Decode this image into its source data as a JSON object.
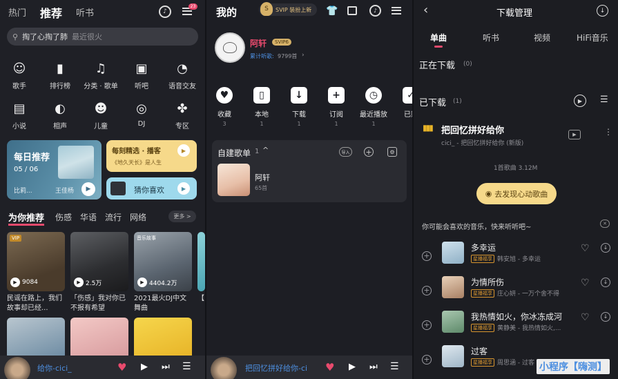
{
  "left_panel": {
    "tabs": [
      "热门",
      "推荐",
      "听书"
    ],
    "notification_badge": "23",
    "search": {
      "hot": "掏了心掏了肺",
      "hint": "最近很火"
    },
    "categories": [
      {
        "icon": "singer-icon",
        "label": "歌手"
      },
      {
        "icon": "ranking-icon",
        "label": "排行榜"
      },
      {
        "icon": "song-sheet-icon",
        "label": "分类 · 歌单"
      },
      {
        "icon": "radio-icon",
        "label": "听吧"
      },
      {
        "icon": "chat-icon",
        "label": "语音交友"
      },
      {
        "icon": "novel-icon",
        "label": "小说"
      },
      {
        "icon": "crosstalk-icon",
        "label": "相声"
      },
      {
        "icon": "kids-icon",
        "label": "儿童"
      },
      {
        "icon": "dj-icon",
        "label": "DJ"
      },
      {
        "icon": "zone-icon",
        "label": "专区"
      }
    ],
    "daily": {
      "title": "每日推荐",
      "date": "05 / 06",
      "song": "比莉...",
      "artist": "王佳杨"
    },
    "moment": {
      "title": "每刻精选 · 播客",
      "subtitle": "《地久天长》是人生"
    },
    "guess": {
      "title": "猜你喜欢"
    },
    "rec_tabs": [
      "为你推荐",
      "伤感",
      "华语",
      "流行",
      "网络"
    ],
    "more": "更多 >",
    "tiles": [
      {
        "tag": "VIP",
        "plays": "9084",
        "caption": "民谣在路上，我们故事却已经..."
      },
      {
        "tag": "",
        "plays": "2.5万",
        "caption": "「伤感」我对你已不报有希望"
      },
      {
        "tag": "音乐故事",
        "plays": "4404.2万",
        "caption": "2021最火DJ中文舞曲"
      },
      {
        "tag": "",
        "plays": "",
        "caption": "【..."
      }
    ],
    "player": {
      "now": "给你-cici_"
    }
  },
  "middle_panel": {
    "title": "我的",
    "svip_banner": "SVIP 装扮上新",
    "user": {
      "name": "阿轩",
      "level": "SVIP6",
      "listen_label": "累计听歌:",
      "listen_count": "9799首"
    },
    "functions": [
      {
        "icon": "heart-icon",
        "label": "收藏",
        "count": "3"
      },
      {
        "icon": "phone-icon",
        "label": "本地",
        "count": "1"
      },
      {
        "icon": "download-icon",
        "label": "下载",
        "count": "1"
      },
      {
        "icon": "subscribe-icon",
        "label": "订阅",
        "count": "1"
      },
      {
        "icon": "clock-icon",
        "label": "最近播放",
        "count": "1"
      },
      {
        "icon": "check-icon",
        "label": "已购",
        "count": ""
      }
    ],
    "playlist_header": {
      "title": "自建歌单",
      "count": "1",
      "import": "导入"
    },
    "playlist": {
      "name": "阿轩",
      "count": "65首"
    },
    "player": {
      "now": "把回忆拼好给你-ci"
    }
  },
  "right_panel": {
    "title": "下载管理",
    "tabs": [
      "单曲",
      "听书",
      "视频",
      "HiFi音乐"
    ],
    "downloading": {
      "label": "正在下载",
      "count": "(0)"
    },
    "downloaded": {
      "label": "已下载",
      "count": "(1)"
    },
    "track": {
      "title": "把回忆拼好给你",
      "sub": "cici_ - 把回忆拼好给你 (新版)"
    },
    "summary": "1首歌曲  3.12M",
    "discover_button": "去发现心动歌曲",
    "maybe_like": "你可能会喜欢的音乐，快来听听吧~",
    "songs": [
      {
        "title": "多幸运",
        "badge": "星播福享",
        "sub": "韩安旭 - 多幸运"
      },
      {
        "title": "为情所伤",
        "badge": "星播福享",
        "sub": "庄心妍 - 一万个舍不得"
      },
      {
        "title": "我热情如火，你冰冻成河",
        "badge": "星播福享",
        "sub": "黄静美 - 我热情如火,..."
      },
      {
        "title": "过客",
        "badge": "星播福享",
        "sub": "周思涵 - 过客"
      }
    ],
    "watermark": "小程序【嗨测】"
  },
  "colors": {
    "accent": "#e84a6d",
    "gold": "#f6d98a",
    "link": "#4d8fe0"
  }
}
